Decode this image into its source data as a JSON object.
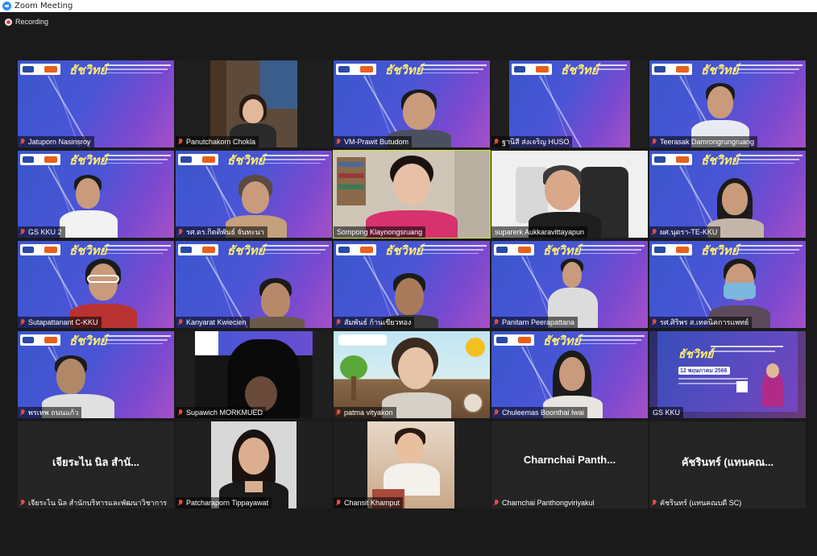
{
  "window": {
    "title": "Zoom Meeting"
  },
  "recording": {
    "label": "Recording"
  },
  "colors": {
    "active_speaker_outline": "#cfe236",
    "muted_icon": "#e34d3d",
    "slide_brand": "#ffef72"
  },
  "slide_brand_text": "ธัชวิทย์",
  "participants": [
    {
      "name": "Jatuporn Nasinsroy",
      "video": "slide"
    },
    {
      "name": "Panutchakorn Chokla",
      "video": "camera"
    },
    {
      "name": "VM-Prawit Butudom",
      "video": "slide-camera"
    },
    {
      "name": "ฐานิสี ส่งเจริญ HUSO",
      "video": "slide"
    },
    {
      "name": "Teerasak Damrongrungruang",
      "video": "slide-camera"
    },
    {
      "name": "GS KKU 2",
      "video": "slide-camera"
    },
    {
      "name": "รศ.ดร.กิตติพันธ์ จันทะนา",
      "video": "slide-camera"
    },
    {
      "name": "Sompong Klaynongsruang",
      "video": "camera",
      "active": true
    },
    {
      "name": "suparerk Aukkaravittayapun",
      "video": "camera"
    },
    {
      "name": "ผศ.นุดรา-TE-KKU",
      "video": "slide-camera"
    },
    {
      "name": "Sutapattanant C-KKU",
      "video": "slide-camera"
    },
    {
      "name": "Kanyarat Kwiecien",
      "video": "slide-camera"
    },
    {
      "name": "สัมพันธ์ ก้านเขียวทอง",
      "video": "slide-camera"
    },
    {
      "name": "Panitarn Peerapattana",
      "video": "slide-camera"
    },
    {
      "name": "รศ.ศิริพร ส.เทคนิคการแพทย์",
      "video": "slide-camera"
    },
    {
      "name": "พรเทพ ถนนแก้ว",
      "video": "slide-camera"
    },
    {
      "name": "Supawich MORKMUED",
      "video": "camera"
    },
    {
      "name": "patma vityakon",
      "video": "camera"
    },
    {
      "name": "Chuleemas Boonthai Iwai",
      "video": "slide-camera"
    },
    {
      "name": "GS KKU",
      "video": "poster",
      "poster_date": "12 พฤษภาคม 2566",
      "poster_brand": "ธัชวิทย์"
    },
    {
      "name": "เจียระไน  นิล สำนักบริหารและพัฒนาวิชาการ",
      "display": "เจียระไน  นิล สำนั...",
      "video": "off"
    },
    {
      "name": "Patcharaporn Tippayawat",
      "video": "camera"
    },
    {
      "name": "Chansit Khamput",
      "video": "camera"
    },
    {
      "name": "Charnchai Panthongviriyakul",
      "display": "Charnchai  Panth...",
      "video": "off"
    },
    {
      "name": "คัชรินทร์ (แทนคณบดี SC)",
      "display": "คัชรินทร์ (แทนคณ...",
      "video": "off"
    }
  ]
}
